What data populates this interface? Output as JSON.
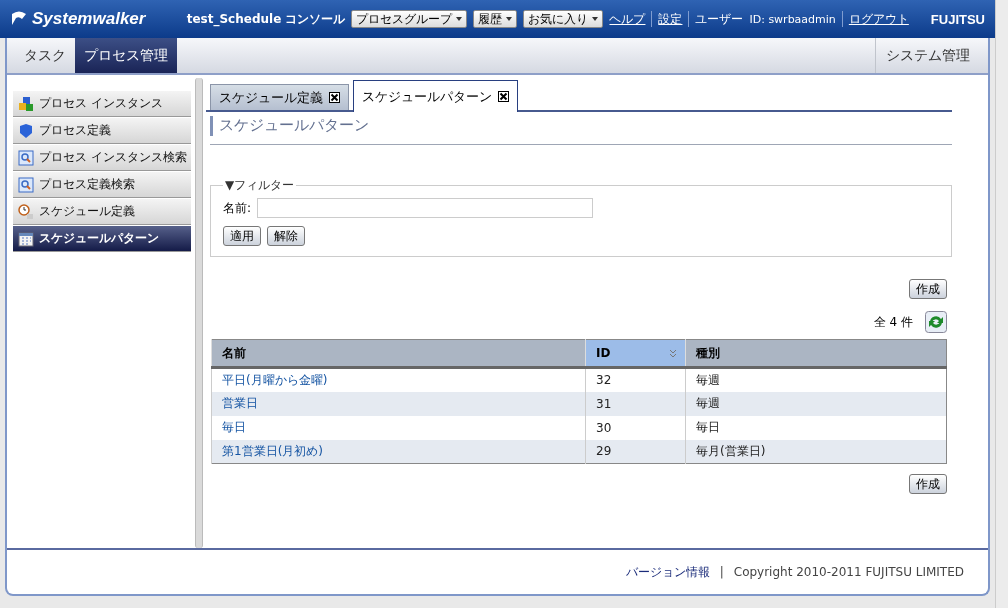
{
  "header": {
    "logo": "Systemwalker",
    "console_title": "test_Schedule コンソール",
    "menus": [
      {
        "label": "プロセスグループ"
      },
      {
        "label": "履歴"
      },
      {
        "label": "お気に入り"
      }
    ],
    "links": [
      "ヘルプ",
      "設定"
    ],
    "user_label": "ユーザー",
    "user_id": "ID: swrbaadmin",
    "logout": "ログアウト",
    "brand": "FUJITSU"
  },
  "nav_tabs": [
    {
      "label": "タスク",
      "selected": false
    },
    {
      "label": "プロセス管理",
      "selected": true
    }
  ],
  "nav_right": "システム管理",
  "sidebar": {
    "items": [
      {
        "label": "プロセス インスタンス",
        "kind": "cubes",
        "selected": false
      },
      {
        "label": "プロセス定義",
        "kind": "shield",
        "selected": false
      },
      {
        "label": "プロセス インスタンス検索",
        "kind": "search",
        "selected": false
      },
      {
        "label": "プロセス定義検索",
        "kind": "search",
        "selected": false
      },
      {
        "label": "スケジュール定義",
        "kind": "clock",
        "selected": false
      },
      {
        "label": "スケジュールパターン",
        "kind": "calendar",
        "selected": true
      }
    ]
  },
  "content_tabs": [
    {
      "label": "スケジュール定義",
      "selected": false
    },
    {
      "label": "スケジュールパターン",
      "selected": true
    }
  ],
  "page_title": "スケジュールパターン",
  "filter": {
    "legend": "▼フィルター",
    "name_label": "名前:",
    "buttons": [
      "適用",
      "解除"
    ]
  },
  "create_top": "作成",
  "count": "全 4 件",
  "table": {
    "columns": [
      {
        "label": "名前",
        "sorted": false
      },
      {
        "label": "ID",
        "sorted": true
      },
      {
        "label": "種別",
        "sorted": false
      }
    ],
    "rows": [
      [
        "平日(月曜から金曜)",
        "32",
        "毎週"
      ],
      [
        "営業日",
        "31",
        "毎週"
      ],
      [
        "毎日",
        "30",
        "毎日"
      ],
      [
        "第1営業日(月初め)",
        "29",
        "毎月(営業日)"
      ]
    ]
  },
  "create_bottom": "作成",
  "footer": {
    "link": "バージョン情報",
    "separator": "|",
    "copyright": "Copyright 2010-2011 FUJITSU LIMITED"
  }
}
